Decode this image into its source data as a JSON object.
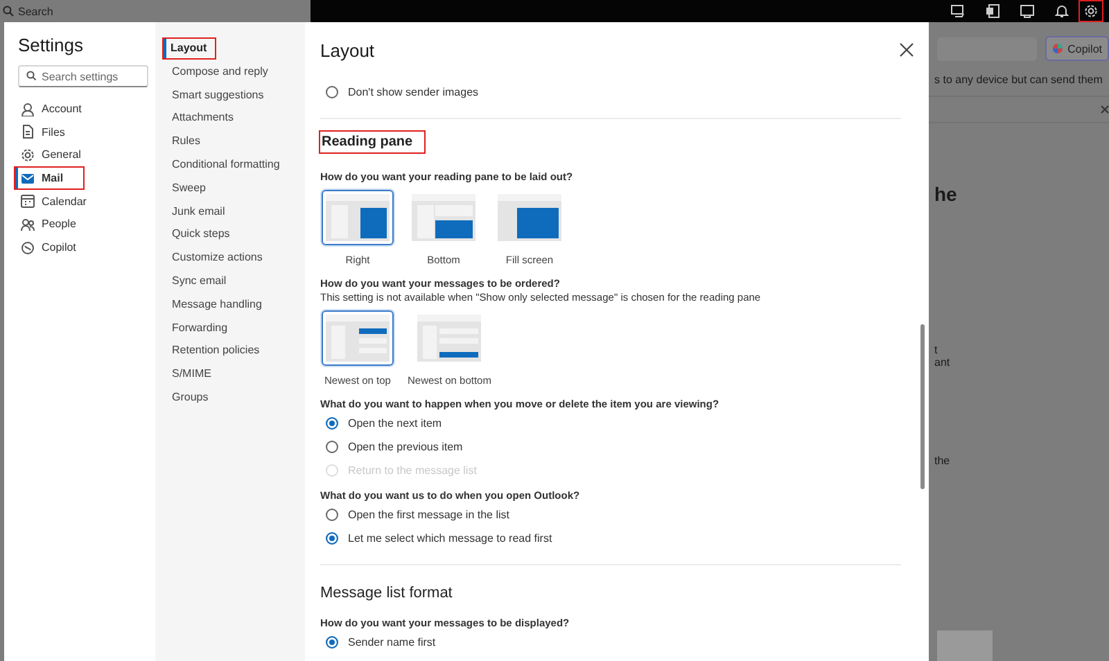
{
  "top_bar": {
    "search": {
      "placeholder": "Search"
    },
    "settings_button": {
      "highlighted": true
    }
  },
  "settings": {
    "title": "Settings",
    "search": {
      "placeholder": "Search settings"
    },
    "categories": [
      {
        "label": "Account",
        "selected": false,
        "highlighted": false
      },
      {
        "label": "Files",
        "selected": false,
        "highlighted": false
      },
      {
        "label": "General",
        "selected": false,
        "highlighted": false
      },
      {
        "label": "Mail",
        "selected": true,
        "highlighted": true
      },
      {
        "label": "Calendar",
        "selected": false,
        "highlighted": false
      },
      {
        "label": "People",
        "selected": false,
        "highlighted": false
      },
      {
        "label": "Copilot",
        "selected": false,
        "highlighted": false
      }
    ],
    "subnav": [
      {
        "label": "Layout",
        "selected": true,
        "highlighted": true
      },
      {
        "label": "Compose and reply",
        "selected": false,
        "highlighted": false
      },
      {
        "label": "Smart suggestions",
        "selected": false,
        "highlighted": false
      },
      {
        "label": "Attachments",
        "selected": false,
        "highlighted": false
      },
      {
        "label": "Rules",
        "selected": false,
        "highlighted": false
      },
      {
        "label": "Conditional formatting",
        "selected": false,
        "highlighted": false
      },
      {
        "label": "Sweep",
        "selected": false,
        "highlighted": false
      },
      {
        "label": "Junk email",
        "selected": false,
        "highlighted": false
      },
      {
        "label": "Quick steps",
        "selected": false,
        "highlighted": false
      },
      {
        "label": "Customize actions",
        "selected": false,
        "highlighted": false
      },
      {
        "label": "Sync email",
        "selected": false,
        "highlighted": false
      },
      {
        "label": "Message handling",
        "selected": false,
        "highlighted": false
      },
      {
        "label": "Forwarding",
        "selected": false,
        "highlighted": false
      },
      {
        "label": "Retention policies",
        "selected": false,
        "highlighted": false
      },
      {
        "label": "S/MIME",
        "selected": false,
        "highlighted": false
      },
      {
        "label": "Groups",
        "selected": false,
        "highlighted": false
      }
    ]
  },
  "panel": {
    "title": "Layout",
    "blocks": [
      {
        "kind": "radio",
        "label": "Don't show sender images",
        "checked": false,
        "disabled": false
      },
      {
        "kind": "divider"
      },
      {
        "kind": "heading",
        "text": "Reading pane",
        "highlighted": true
      },
      {
        "kind": "question",
        "text": "How do you want your reading pane to be laid out?"
      },
      {
        "kind": "thumbs",
        "options": [
          {
            "label": "Right",
            "kind": "right",
            "selected": true
          },
          {
            "label": "Bottom",
            "kind": "bottom",
            "selected": false
          },
          {
            "label": "Fill screen",
            "kind": "fill",
            "selected": false
          }
        ]
      },
      {
        "kind": "question",
        "text": "How do you want your messages to be ordered?"
      },
      {
        "kind": "note",
        "text": "This setting is not available when \"Show only selected message\" is chosen for the reading pane"
      },
      {
        "kind": "thumbs",
        "options": [
          {
            "label": "Newest on top",
            "kind": "newest_top",
            "selected": true
          },
          {
            "label": "Newest on bottom",
            "kind": "newest_bottom",
            "selected": false
          }
        ]
      },
      {
        "kind": "question",
        "text": "What do you want to happen when you move or delete the item you are viewing?"
      },
      {
        "kind": "radio",
        "label": "Open the next item",
        "checked": true,
        "disabled": false
      },
      {
        "kind": "radio",
        "label": "Open the previous item",
        "checked": false,
        "disabled": false
      },
      {
        "kind": "radio",
        "label": "Return to the message list",
        "checked": false,
        "disabled": true
      },
      {
        "kind": "question",
        "text": "What do you want us to do when you open Outlook?"
      },
      {
        "kind": "radio",
        "label": "Open the first message in the list",
        "checked": false,
        "disabled": false
      },
      {
        "kind": "radio",
        "label": "Let me select which message to read first",
        "checked": true,
        "disabled": false
      },
      {
        "kind": "divider"
      },
      {
        "kind": "title",
        "text": "Message list format"
      },
      {
        "kind": "question",
        "text": "How do you want your messages to be displayed?"
      },
      {
        "kind": "radio",
        "label": "Sender name first",
        "checked": true,
        "disabled": false
      }
    ]
  },
  "backdrop": {
    "copilot_button": "Copilot",
    "banner": "s to any device but can send them",
    "fragments": [
      {
        "text": "he",
        "kind": "large"
      },
      {
        "text": "t",
        "kind": "small"
      },
      {
        "text": "ant",
        "kind": "small"
      },
      {
        "text": "the",
        "kind": "small"
      }
    ]
  }
}
